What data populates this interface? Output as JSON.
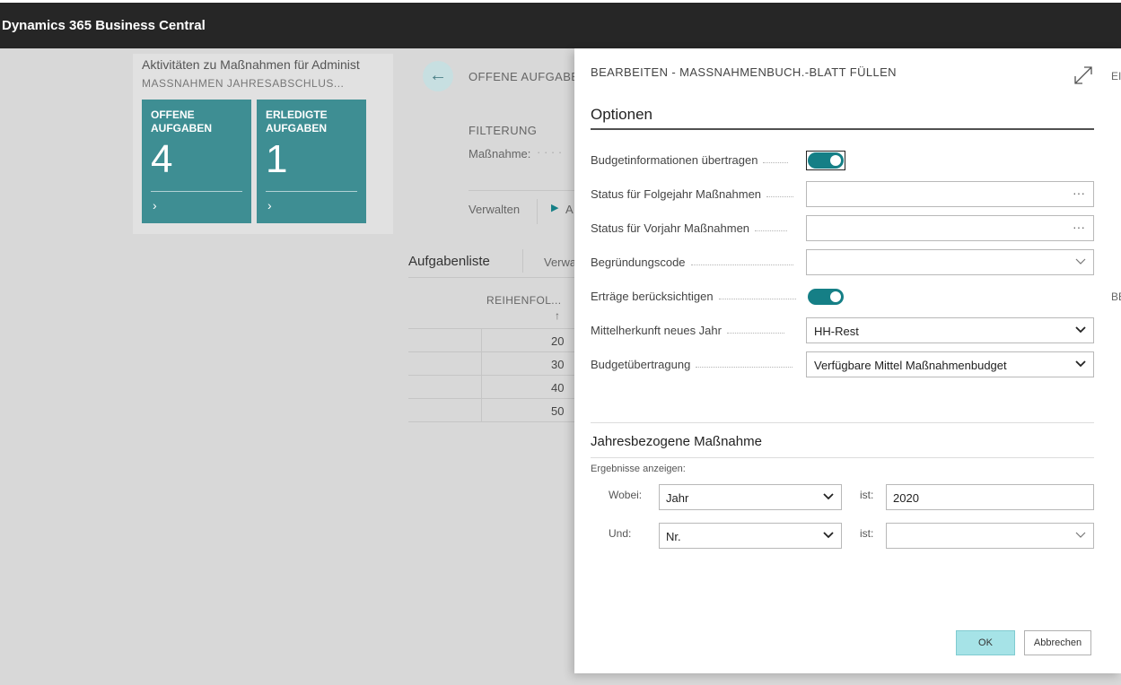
{
  "app": {
    "title": "Dynamics 365 Business Central"
  },
  "background": {
    "heading": "Aktivitäten zu Maßnahmen für Administ",
    "subheading": "MASSNAHMEN JAHRESABSCHLUS...",
    "tiles": [
      {
        "label": "OFFENE AUFGABEN",
        "count": "4",
        "chevron": "›"
      },
      {
        "label": "ERLEDIGTE AUFGABEN",
        "count": "1",
        "chevron": "›"
      }
    ],
    "page_header": "OFFENE AUFGABE",
    "filter_title": "FILTERUNG",
    "filter_label": "Maßnahme:",
    "manage_label": "Verwalten",
    "action_label": "A",
    "list_title": "Aufgabenliste",
    "list_manage": "Verwa",
    "column_header": "REIHENFOL...",
    "sort_indicator": "↑",
    "rows": [
      "20",
      "30",
      "40",
      "50"
    ],
    "right_edge_top": "EI",
    "right_edge_mid": "BE"
  },
  "dialog": {
    "title": "BEARBEITEN - MASSNAHMENBUCH.-BLATT FÜLLEN",
    "options_title": "Optionen",
    "fields": {
      "budget_transfer_label": "Budgetinformationen übertragen",
      "status_next_label": "Status für Folgejahr Maßnahmen",
      "status_next_value": "",
      "status_prev_label": "Status für Vorjahr Maßnahmen",
      "status_prev_value": "",
      "reason_label": "Begründungscode",
      "reason_value": "",
      "income_label": "Erträge berücksichtigen",
      "fund_source_label": "Mittelherkunft neues Jahr",
      "fund_source_value": "HH-Rest",
      "budget_carry_label": "Budgetübertragung",
      "budget_carry_value": "Verfügbare Mittel Maßnahmenbudget",
      "ellipsis": "···"
    },
    "toggles": {
      "budget_transfer": true,
      "income": true
    },
    "year_section": {
      "title": "Jahresbezogene Maßnahme",
      "results_label": "Ergebnisse anzeigen:",
      "filters": [
        {
          "prefix": "Wobei:",
          "field": "Jahr",
          "op": "ist:",
          "value": "2020"
        },
        {
          "prefix": "Und:",
          "field": "Nr.",
          "op": "ist:",
          "value": ""
        }
      ]
    },
    "buttons": {
      "ok": "OK",
      "cancel": "Abbrechen"
    }
  },
  "colors": {
    "accent": "#157f86",
    "tile": "#3e8e93",
    "topbar": "#262626",
    "ok_button": "#a6e3e7"
  }
}
